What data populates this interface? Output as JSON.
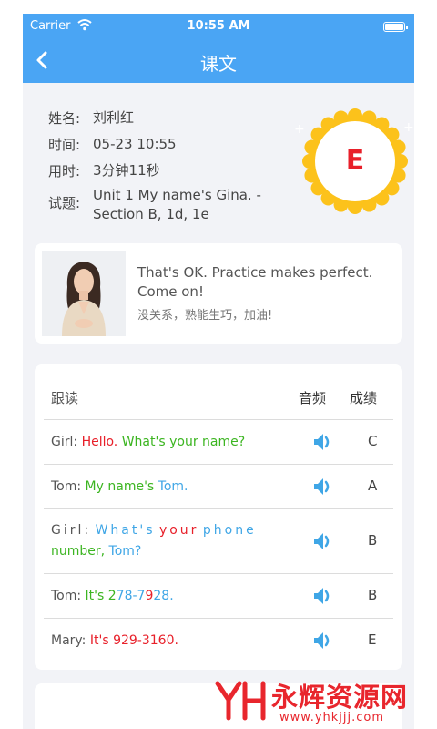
{
  "status": {
    "carrier": "Carrier",
    "time": "10:55 AM"
  },
  "nav": {
    "title": "课文"
  },
  "info": {
    "name_label": "姓名:",
    "name_value": "刘利红",
    "time_label": "时间:",
    "time_value": "05-23 10:55",
    "duration_label": "用时:",
    "duration_value": "3分钟11秒",
    "test_label": "试题:",
    "test_line1": "Unit 1 My name's Gina. -",
    "test_line2": "Section B, 1d, 1e"
  },
  "badge": {
    "grade": "E"
  },
  "feedback": {
    "text_en": "That's OK. Practice makes perfect. Come on!",
    "text_zh": "没关系，熟能生巧，加油!"
  },
  "table": {
    "headers": {
      "read": "跟读",
      "audio": "音频",
      "score": "成绩"
    },
    "rows": [
      {
        "speaker": "Girl:",
        "p1": "Hello.",
        "p2": "What's your name?",
        "score": "C"
      },
      {
        "speaker": "Tom:",
        "p1": "My name's",
        "p2": "Tom.",
        "score": "A"
      },
      {
        "speaker": "Girl:",
        "p1": "What's",
        "p2": "your",
        "p3": "phone",
        "p4": "number,",
        "p5": "Tom?",
        "score": "B"
      },
      {
        "speaker": "Tom:",
        "p1": "It's 2",
        "p2": "78-7",
        "p3": "9",
        "p4": "28.",
        "score": "B"
      },
      {
        "speaker": "Mary:",
        "p1": "It's 929-3160.",
        "score": "E"
      }
    ]
  },
  "watermark": {
    "text": "永辉资源网",
    "url": "www.yhkjjj.com"
  },
  "colors": {
    "nav": "#4aa5f4",
    "red": "#e8202a",
    "green": "#3cb521",
    "blue": "#3fa6e6",
    "badge_gold": "#fcc21b"
  }
}
